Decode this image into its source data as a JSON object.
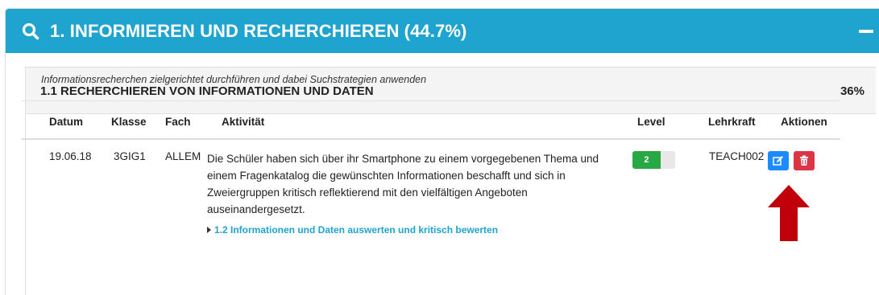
{
  "section": {
    "title": "1. INFORMIEREN UND RECHERCHIEREN (44.7%)",
    "icon": "search-icon",
    "collapse_icon": "minus-icon",
    "header_color": "#1fa3cf"
  },
  "subsection": {
    "title": "1.1 RECHERCHIEREN VON INFORMATIONEN UND DATEN",
    "percent": "36%",
    "description": "Informationsrecherchen zielgerichtet durchführen und dabei Suchstrategien anwenden"
  },
  "table": {
    "headers": {
      "datum": "Datum",
      "klasse": "Klasse",
      "fach": "Fach",
      "aktivitaet": "Aktivität",
      "level": "Level",
      "lehrkraft": "Lehrkraft",
      "aktionen": "Aktionen"
    },
    "rows": [
      {
        "datum": "19.06.18",
        "klasse": "3GIG1",
        "fach": "ALLEM",
        "aktivitaet": "Die Schüler haben sich über ihr Smartphone zu einem vorgegebenen Thema und einem Fragenkatalog die gewünschten Informationen beschafft und sich in Zweiergruppen kritisch reflektierend mit den vielfältigen Angeboten auseinandergesetzt.",
        "link": "1.2 Informationen und Daten auswerten und kritisch bewerten",
        "level": "2",
        "level_fraction": 0.66,
        "level_color": "#28a745",
        "lehrkraft": "TEACH002",
        "edit_icon": "edit-icon",
        "delete_icon": "trash-icon",
        "edit_color": "#1a8cff",
        "delete_color": "#dc3545"
      }
    ]
  },
  "annotation": {
    "arrow_color": "#c0000b",
    "icon": "arrow-up-icon"
  }
}
